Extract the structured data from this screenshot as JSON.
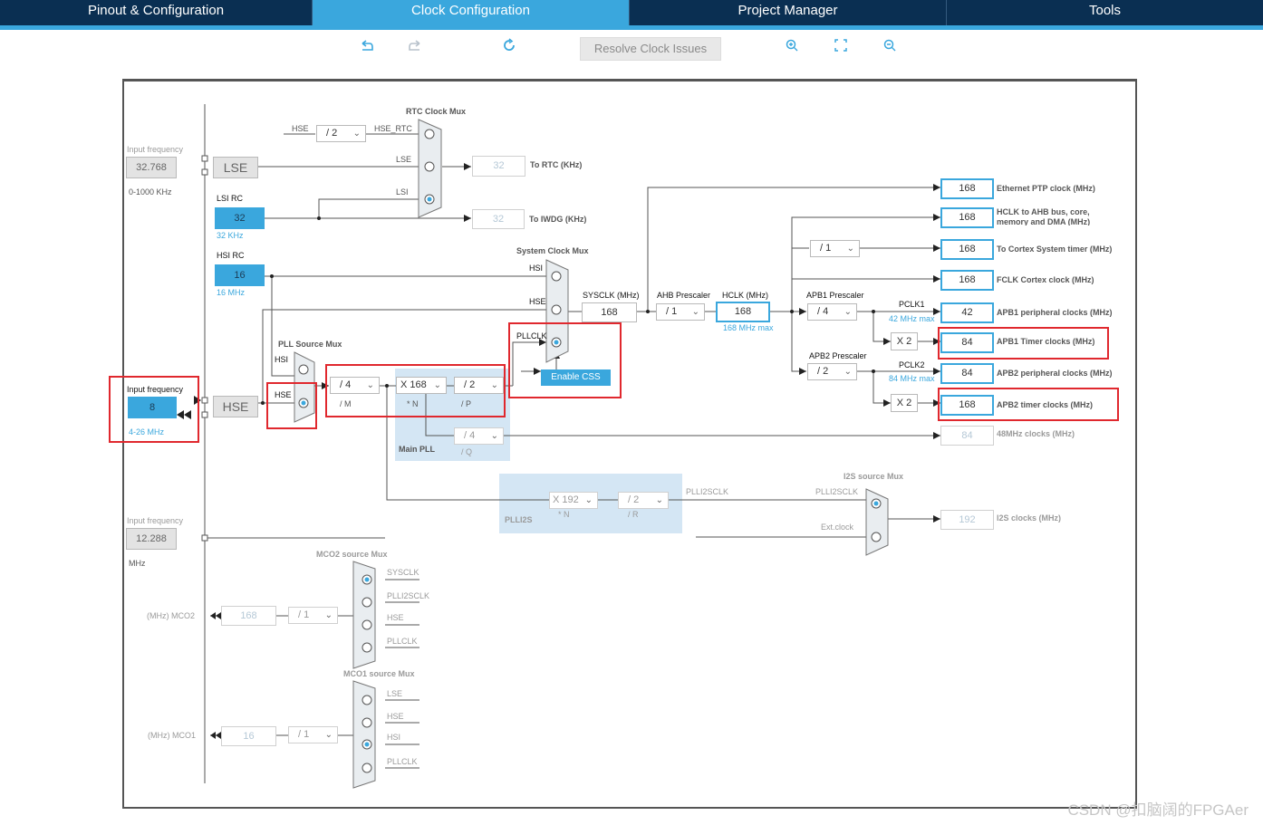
{
  "tabs": [
    {
      "label": "Pinout & Configuration"
    },
    {
      "label": "Clock Configuration"
    },
    {
      "label": "Project Manager"
    },
    {
      "label": "Tools"
    }
  ],
  "toolbar": {
    "resolve_label": "Resolve Clock Issues"
  },
  "icons": {
    "undo": "undo-icon",
    "redo": "redo-icon",
    "refresh": "refresh-icon",
    "zoom_in": "zoom-in-icon",
    "fit": "fit-screen-icon",
    "zoom_out": "zoom-out-icon"
  },
  "colors": {
    "accent": "#3aa7dd",
    "header": "#0a2f52",
    "highlight": "#e0282e"
  },
  "lse": {
    "input_label": "Input frequency",
    "value": "32.768",
    "range": "0-1000 KHz",
    "block": "LSE"
  },
  "lsi": {
    "title": "LSI RC",
    "value": "32",
    "unit": "32 KHz"
  },
  "hsi": {
    "title": "HSI RC",
    "value": "16",
    "unit": "16 MHz"
  },
  "hse": {
    "input_label": "Input frequency",
    "value": "8",
    "range": "4-26 MHz",
    "block": "HSE"
  },
  "i2s_input": {
    "label": "Input frequency",
    "value": "12.288",
    "unit": "MHz"
  },
  "rtc": {
    "mux_title": "RTC Clock Mux",
    "hse_label": "HSE",
    "div": "/ 2",
    "hse_rtc": "HSE_RTC",
    "lse": "LSE",
    "lsi": "LSI",
    "rtc_value": "32",
    "rtc_label": "To RTC (KHz)",
    "iwdg_value": "32",
    "iwdg_label": "To IWDG (KHz)"
  },
  "sysmux": {
    "title": "System Clock Mux",
    "hsi": "HSI",
    "hse": "HSE",
    "pllclk": "PLLCLK",
    "css": "Enable CSS"
  },
  "pll": {
    "mux_title": "PLL Source Mux",
    "hsi": "HSI",
    "hse": "HSE",
    "m": "/ 4",
    "m_lbl": "/ M",
    "n": "X 168",
    "n_lbl": "* N",
    "p": "/ 2",
    "p_lbl": "/ P",
    "q": "/ 4",
    "q_lbl": "/ Q",
    "title": "Main PLL"
  },
  "sysclk": {
    "label": "SYSCLK (MHz)",
    "value": "168"
  },
  "ahb": {
    "label": "AHB Prescaler",
    "value": "/ 1"
  },
  "hclk": {
    "label": "HCLK (MHz)",
    "value": "168",
    "max": "168 MHz max"
  },
  "apb1": {
    "label": "APB1 Prescaler",
    "value": "/ 4",
    "pclk": "PCLK1",
    "max": "42 MHz max",
    "mult": "X 2"
  },
  "apb2": {
    "label": "APB2 Prescaler",
    "value": "/ 2",
    "pclk": "PCLK2",
    "max": "84 MHz max",
    "mult": "X 2"
  },
  "cortex_div": "/ 1",
  "outputs": [
    {
      "value": "168",
      "label": "Ethernet PTP clock (MHz)"
    },
    {
      "value": "168",
      "label": "HCLK to AHB bus, core,",
      "label2": "memory and DMA (MHz)"
    },
    {
      "value": "168",
      "label": "To Cortex System timer (MHz)"
    },
    {
      "value": "168",
      "label": "FCLK Cortex clock (MHz)"
    },
    {
      "value": "42",
      "label": "APB1 peripheral clocks (MHz)"
    },
    {
      "value": "84",
      "label": "APB1 Timer clocks (MHz)"
    },
    {
      "value": "84",
      "label": "APB2 peripheral clocks (MHz)"
    },
    {
      "value": "168",
      "label": "APB2 timer clocks (MHz)"
    },
    {
      "value": "84",
      "label": "48MHz clocks (MHz)"
    }
  ],
  "plli2s": {
    "n": "X 192",
    "n_lbl": "* N",
    "r": "/ 2",
    "r_lbl": "/ R",
    "title": "PLLI2S",
    "out": "PLLI2SCLK"
  },
  "i2s": {
    "mux_title": "I2S source Mux",
    "in1": "PLLI2SCLK",
    "in2": "Ext.clock",
    "value": "192",
    "label": "I2S clocks (MHz)"
  },
  "mco2": {
    "mux_title": "MCO2 source Mux",
    "inputs": [
      "SYSCLK",
      "PLLI2SCLK",
      "HSE",
      "PLLCLK"
    ],
    "div": "/ 1",
    "value": "168",
    "label": "(MHz) MCO2"
  },
  "mco1": {
    "mux_title": "MCO1 source Mux",
    "inputs": [
      "LSE",
      "HSE",
      "HSI",
      "PLLCLK"
    ],
    "div": "/ 1",
    "value": "16",
    "label": "(MHz) MCO1"
  },
  "watermark": "CSDN @扣脑阔的FPGAer"
}
